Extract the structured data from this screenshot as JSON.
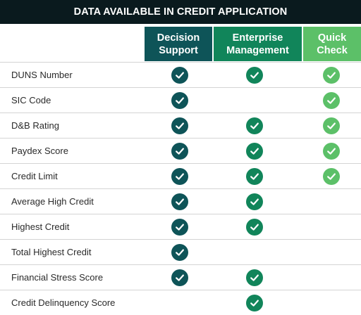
{
  "title": "DATA AVAILABLE IN CREDIT APPLICATION",
  "columns": [
    {
      "label": "Decision\nSupport",
      "color": "#0e5458"
    },
    {
      "label": "Enterprise\nManagement",
      "color": "#11855a"
    },
    {
      "label": "Quick\nCheck",
      "color": "#5cc068"
    }
  ],
  "check_colors": {
    "decision_support": "#0e5458",
    "enterprise_management": "#11855a",
    "quick_check": "#5cc068"
  },
  "icon": "check-circle",
  "rows": [
    {
      "label": "DUNS Number",
      "checks": [
        true,
        true,
        true
      ]
    },
    {
      "label": "SIC Code",
      "checks": [
        true,
        false,
        true
      ]
    },
    {
      "label": "D&B Rating",
      "checks": [
        true,
        true,
        true
      ]
    },
    {
      "label": "Paydex Score",
      "checks": [
        true,
        true,
        true
      ]
    },
    {
      "label": "Credit Limit",
      "checks": [
        true,
        true,
        true
      ]
    },
    {
      "label": "Average High Credit",
      "checks": [
        true,
        true,
        false
      ]
    },
    {
      "label": "Highest Credit",
      "checks": [
        true,
        true,
        false
      ]
    },
    {
      "label": "Total Highest Credit",
      "checks": [
        true,
        false,
        false
      ]
    },
    {
      "label": "Financial Stress Score",
      "checks": [
        true,
        true,
        false
      ]
    },
    {
      "label": "Credit Delinquency Score",
      "checks": [
        false,
        true,
        false
      ]
    }
  ]
}
